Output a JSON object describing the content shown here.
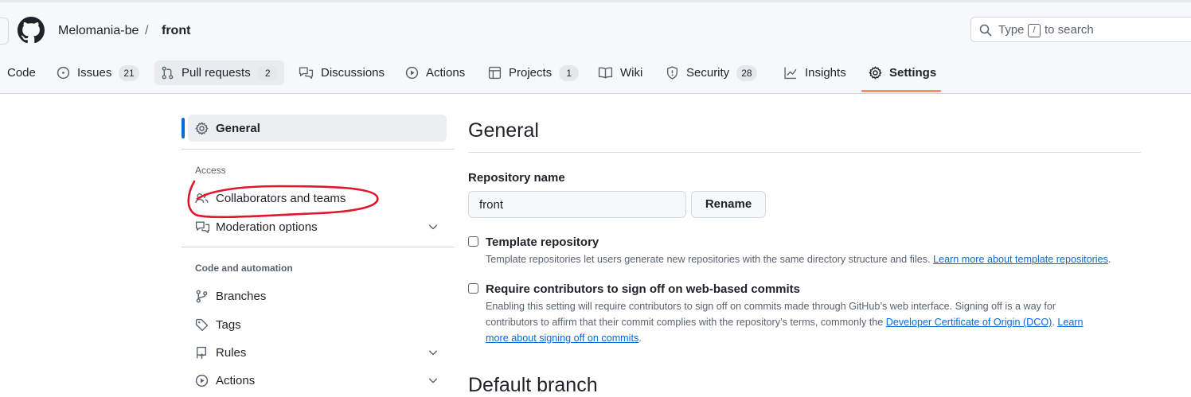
{
  "header": {
    "owner": "Melomania-be",
    "separator": "/",
    "repo": "front",
    "search_prefix": "Type",
    "search_key": "/",
    "search_suffix": "to search"
  },
  "tabs": [
    {
      "label": "Code",
      "icon": "code-icon"
    },
    {
      "label": "Issues",
      "count": "21",
      "icon": "issue-opened-icon"
    },
    {
      "label": "Pull requests",
      "count": "2",
      "icon": "git-pull-request-icon"
    },
    {
      "label": "Discussions",
      "icon": "comment-discussion-icon"
    },
    {
      "label": "Actions",
      "icon": "play-icon"
    },
    {
      "label": "Projects",
      "count": "1",
      "icon": "table-icon"
    },
    {
      "label": "Wiki",
      "icon": "book-icon"
    },
    {
      "label": "Security",
      "count": "28",
      "icon": "shield-icon"
    },
    {
      "label": "Insights",
      "icon": "graph-icon"
    },
    {
      "label": "Settings",
      "icon": "gear-icon"
    }
  ],
  "sidebar": {
    "general": "General",
    "access_heading": "Access",
    "collaborators": "Collaborators and teams",
    "moderation": "Moderation options",
    "automation_heading": "Code and automation",
    "branches": "Branches",
    "tags": "Tags",
    "rules": "Rules",
    "actions": "Actions"
  },
  "main": {
    "title": "General",
    "repo_name_label": "Repository name",
    "repo_name_value": "front",
    "rename_button": "Rename",
    "template": {
      "label": "Template repository",
      "desc": "Template repositories let users generate new repositories with the same directory structure and files.",
      "link": "Learn more about template repositories",
      "after": "."
    },
    "signoff": {
      "label": "Require contributors to sign off on web-based commits",
      "line1": "Enabling this setting will require contributors to sign off on commits made through GitHub’s web interface. Signing off is a way for",
      "line2": "contributors to affirm that their commit complies with the repository’s terms, commonly the",
      "link1": "Developer Certificate of Origin (DCO)",
      "sep": ".",
      "link2a": "Learn",
      "link2b": "more about signing off on commits",
      "after": "."
    },
    "next_section": "Default branch"
  },
  "colors": {
    "accent_underline": "#fd8c73",
    "active_bar": "#0969da",
    "link": "#0969da",
    "annotation": "#e0162b"
  }
}
